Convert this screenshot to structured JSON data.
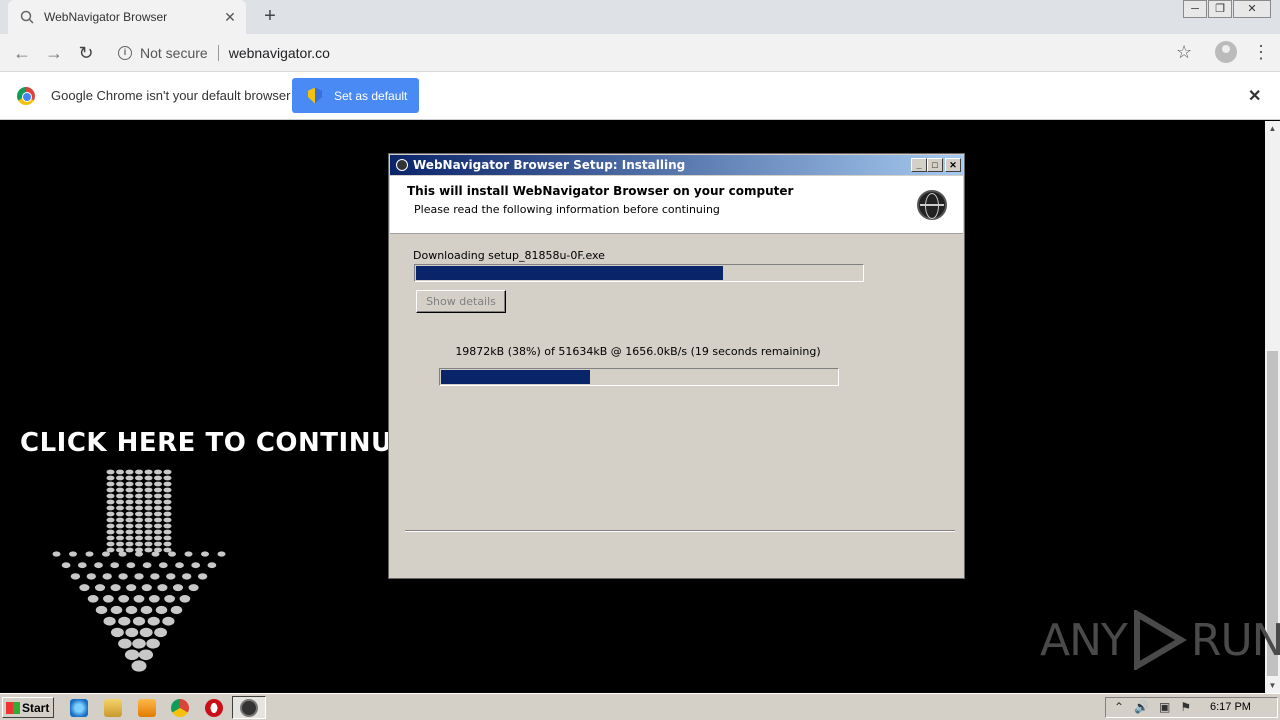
{
  "browser": {
    "tab_title": "WebNavigator Browser",
    "tab_close": "✕",
    "new_tab": "+",
    "security_label": "Not secure",
    "url": "webnavigator.co"
  },
  "infobar": {
    "message": "Google Chrome isn't your default browser",
    "button_label": "Set as default",
    "close": "✕"
  },
  "page": {
    "cta_text": "CLICK HERE TO CONTINUE",
    "watermark_left": "ANY",
    "watermark_right": "RUN"
  },
  "installer": {
    "title": "WebNavigator Browser Setup: Installing",
    "heading": "This will install WebNavigator Browser on your computer",
    "subheading": "Please read the following information before continuing",
    "download_label": "Downloading setup_81858u-0F.exe",
    "show_details_label": "Show details",
    "status_text": "19872kB (38%) of 51634kB @ 1656.0kB/s (19 seconds remaining)",
    "overall_progress": 0.69,
    "file_progress": 0.38
  },
  "taskbar": {
    "start_label": "Start",
    "clock": "6:17 PM",
    "pinned_icons": [
      "ie-icon",
      "explorer-icon",
      "media-player-icon",
      "chrome-icon",
      "opera-icon"
    ],
    "active_task_icon": "webnavigator-icon"
  },
  "colors": {
    "accent": "#4a8af4",
    "progress_fill": "#0a246a",
    "dialog_bg": "#d4d0c8"
  }
}
